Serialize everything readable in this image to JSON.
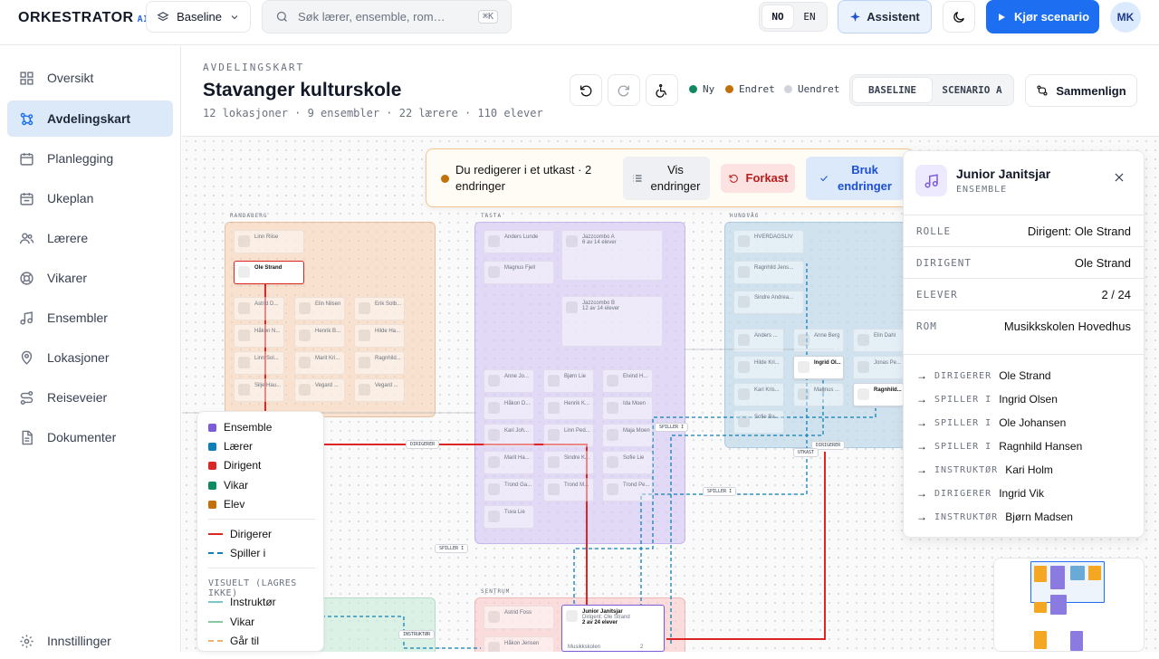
{
  "app": {
    "name": "ORKESTRATOR",
    "badge": "AI"
  },
  "topbar": {
    "scenario_label": "Baseline",
    "search_placeholder": "Søk lærer, ensemble, rom…",
    "search_shortcut": "⌘K",
    "lang_no": "NO",
    "lang_en": "EN",
    "assistant": "Assistent",
    "run": "Kjør scenario",
    "avatar": "MK"
  },
  "sidebar": {
    "items": [
      {
        "label": "Oversikt",
        "icon": "grid-icon"
      },
      {
        "label": "Avdelingskart",
        "icon": "graph-icon",
        "active": true
      },
      {
        "label": "Planlegging",
        "icon": "calendar-icon"
      },
      {
        "label": "Ukeplan",
        "icon": "calendar-week-icon"
      },
      {
        "label": "Lærere",
        "icon": "users-icon"
      },
      {
        "label": "Vikarer",
        "icon": "lifebuoy-icon"
      },
      {
        "label": "Ensembler",
        "icon": "music-icon"
      },
      {
        "label": "Lokasjoner",
        "icon": "map-pin-icon"
      },
      {
        "label": "Reiseveier",
        "icon": "route-icon"
      },
      {
        "label": "Dokumenter",
        "icon": "document-icon"
      }
    ],
    "settings": "Innstillinger"
  },
  "header": {
    "eyebrow": "AVDELINGSKART",
    "title": "Stavanger kulturskole",
    "subtitle": "12 lokasjoner · 9 ensembler · 22 lærere · 110 elever",
    "status_new": "Ny",
    "status_changed": "Endret",
    "status_unchanged": "Uendret",
    "seg_baseline": "BASELINE",
    "seg_scenario": "SCENARIO A",
    "compare": "Sammenlign"
  },
  "colors": {
    "accent": "#1d6ef0",
    "new": "#0f8a5f",
    "changed": "#c2700a",
    "unchanged": "#d1d5db",
    "ensemble": "#7c5cd6",
    "teacher": "#0e7fb8",
    "conductor": "#dc2626",
    "substitute": "#0f8a5f",
    "student": "#c2700a"
  },
  "draft": {
    "text": "Du redigerer i et utkast · 2 endringer",
    "show": "Vis endringer",
    "discard": "Forkast",
    "apply": "Bruk endringer"
  },
  "panel": {
    "title": "Junior Janitsjar",
    "subtitle": "ENSEMBLE",
    "rows": [
      {
        "k": "ROLLE",
        "v": "Dirigent: Ole Strand"
      },
      {
        "k": "DIRIGENT",
        "v": "Ole Strand"
      },
      {
        "k": "ELEVER",
        "v": "2 / 24"
      },
      {
        "k": "ROM",
        "v": "Musikkskolen Hovedhus"
      }
    ],
    "relations": [
      {
        "k": "DIRIGERER",
        "v": "Ole Strand"
      },
      {
        "k": "SPILLER I",
        "v": "Ingrid Olsen"
      },
      {
        "k": "SPILLER I",
        "v": "Ole Johansen"
      },
      {
        "k": "SPILLER I",
        "v": "Ragnhild Hansen"
      },
      {
        "k": "INSTRUKTØR",
        "v": "Kari Holm"
      },
      {
        "k": "DIRIGERER",
        "v": "Ingrid Vik"
      },
      {
        "k": "INSTRUKTØR",
        "v": "Bjørn Madsen"
      }
    ]
  },
  "legend": {
    "ensemble": "Ensemble",
    "teacher": "Lærer",
    "conductor": "Dirigent",
    "substitute": "Vikar",
    "student": "Elev",
    "conducts": "Dirigerer",
    "plays_in": "Spiller i",
    "visual_head": "VISUELT (LAGRES IKKE)",
    "instructor": "Instruktør",
    "substitute_line": "Vikar",
    "goes_to": "Går til"
  },
  "map": {
    "zones": [
      {
        "label": "RANDABERG"
      },
      {
        "label": "TASTA"
      },
      {
        "label": "HUNDVÅG"
      },
      {
        "label": "SENTRUM"
      }
    ],
    "randaberg": [
      "Linn Riise",
      "Ole Strand",
      "Astrid D...",
      "Elin Nilsen",
      "Erik Solb...",
      "Håkon N...",
      "Henrik B...",
      "Hilde Ha...",
      "Linn Sol...",
      "Marit Kri...",
      "Ragnhild...",
      "Silje Hau...",
      "Vegard ...",
      "Vegard ..."
    ],
    "tasta": [
      "Anders Lunde",
      "Magnus Fjell",
      "Jazzcombo A",
      "6 av 14 elever",
      "Jazzcombo B",
      "12 av 14 elever",
      "Anne Jo...",
      "Bjørn Lie",
      "Eivind H...",
      "Håkon D...",
      "Henrik K...",
      "Ida Moen",
      "Kari Joh...",
      "Linn Ped...",
      "Maja Moen",
      "Marit Ha...",
      "Sindre K...",
      "Sofie Lie",
      "Trond Ga...",
      "Trond M...",
      "Trond Pe...",
      "Tuva Lie"
    ],
    "hundvag": [
      "HVERDAGSLIV",
      "Ragnhild Jens...",
      "Sindre Andrea...",
      "Anders ...",
      "Anne Berg",
      "Elin Dahl",
      "Hilde Kri...",
      "Ingrid Ol...",
      "Jonas Pe...",
      "Kari Kris...",
      "Magnus ...",
      "Ragnhild...",
      "Sofie Ba..."
    ],
    "sentrum": [
      "Astrid Foss",
      "Håkon Jensen"
    ],
    "selected_node": {
      "name": "Junior Janitsjar",
      "sub": "Dirigent: Ole Strand",
      "count": "2 av 24 elever",
      "room": "Musikkskolen",
      "num": "2"
    },
    "edges": [
      "DIRIGERER",
      "SPILLER I",
      "SPILLER I",
      "SPILLER I",
      "DIRIGERER",
      "UTKAST",
      "INSTRUKTØR"
    ]
  }
}
